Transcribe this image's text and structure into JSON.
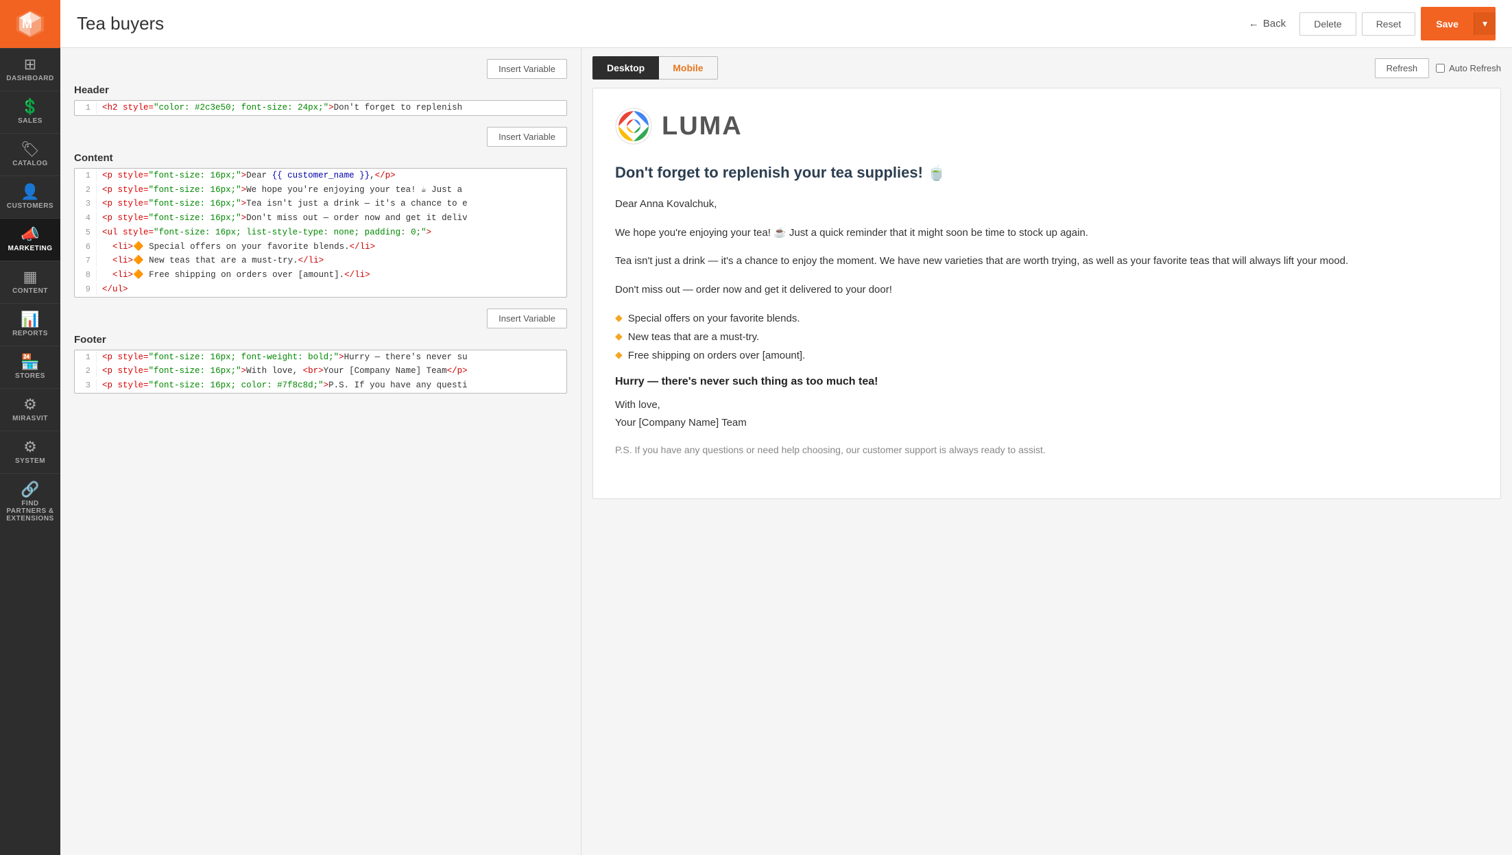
{
  "sidebar": {
    "logo_alt": "Magento Logo",
    "items": [
      {
        "id": "dashboard",
        "label": "DASHBOARD",
        "icon": "⊞"
      },
      {
        "id": "sales",
        "label": "SALES",
        "icon": "$"
      },
      {
        "id": "catalog",
        "label": "CATALOG",
        "icon": "🏷"
      },
      {
        "id": "customers",
        "label": "CUSTOMERS",
        "icon": "👤"
      },
      {
        "id": "marketing",
        "label": "MARKETING",
        "icon": "📣",
        "active": true
      },
      {
        "id": "content",
        "label": "CONTENT",
        "icon": "▦"
      },
      {
        "id": "reports",
        "label": "REPORTS",
        "icon": "📊"
      },
      {
        "id": "stores",
        "label": "STORES",
        "icon": "🏪"
      },
      {
        "id": "mirasvit",
        "label": "MIRASVIT",
        "icon": "⚙"
      },
      {
        "id": "system",
        "label": "SYSTEM",
        "icon": "⚙"
      },
      {
        "id": "find-partners",
        "label": "FIND PARTNERS & EXTENSIONS",
        "icon": "🔗"
      }
    ]
  },
  "topbar": {
    "title": "Tea buyers",
    "back_label": "Back",
    "delete_label": "Delete",
    "reset_label": "Reset",
    "save_label": "Save"
  },
  "editor": {
    "insert_variable_label": "Insert Variable",
    "header_label": "Header",
    "content_label": "Content",
    "footer_label": "Footer",
    "header_code": [
      {
        "num": 1,
        "code": "<h2 style=\"color: #2c3e50; font-size: 24px;\">Don't forget to replenish"
      }
    ],
    "content_code": [
      {
        "num": 1,
        "code": "<p style=\"font-size: 16px;\">Dear {{ customer_name }},</p>"
      },
      {
        "num": 2,
        "code": "<p style=\"font-size: 16px;\">We hope you're enjoying your tea! ☕ Just a"
      },
      {
        "num": 3,
        "code": "<p style=\"font-size: 16px;\">Tea isn't just a drink — it's a chance to e"
      },
      {
        "num": 4,
        "code": "<p style=\"font-size: 16px;\">Don't miss out — order now and get it deliv"
      },
      {
        "num": 5,
        "code": "<ul style=\"font-size: 16px; list-style-type: none; padding: 0;\">"
      },
      {
        "num": 6,
        "code": "  <li>🔶 Special offers on your favorite blends.</li>"
      },
      {
        "num": 7,
        "code": "  <li>🔶 New teas that are a must-try.</li>"
      },
      {
        "num": 8,
        "code": "  <li>🔶 Free shipping on orders over [amount].</li>"
      },
      {
        "num": 9,
        "code": "</ul>"
      }
    ],
    "footer_code": [
      {
        "num": 1,
        "code": "<p style=\"font-size: 16px; font-weight: bold;\">Hurry — there's never su"
      },
      {
        "num": 2,
        "code": "<p style=\"font-size: 16px;\">With love, <br>Your [Company Name] Team</p>"
      },
      {
        "num": 3,
        "code": "<p style=\"font-size: 16px; color: #7f8c8d;\">P.S. If you have any questi"
      }
    ]
  },
  "preview": {
    "desktop_tab": "Desktop",
    "mobile_tab": "Mobile",
    "refresh_label": "Refresh",
    "auto_refresh_label": "Auto Refresh",
    "email": {
      "luma_name": "LUMA",
      "heading": "Don't forget to replenish your tea supplies! 🍵",
      "greeting": "Dear Anna Kovalchuk,",
      "para1": "We hope you're enjoying your tea! ☕ Just a quick reminder that it might soon be time to stock up again.",
      "para2": "Tea isn't just a drink — it's a chance to enjoy the moment. We have new varieties that are worth trying, as well as your favorite teas that will always lift your mood.",
      "para3": "Don't miss out — order now and get it delivered to your door!",
      "list_items": [
        "Special offers on your favorite blends.",
        "New teas that are a must-try.",
        "Free shipping on orders over [amount]."
      ],
      "footer_bold": "Hurry — there's never such thing as too much tea!",
      "footer_love": "With love,",
      "footer_team": "Your [Company Name] Team",
      "footer_ps": "P.S. If you have any questions or need help choosing, our customer support is always ready to assist."
    }
  }
}
